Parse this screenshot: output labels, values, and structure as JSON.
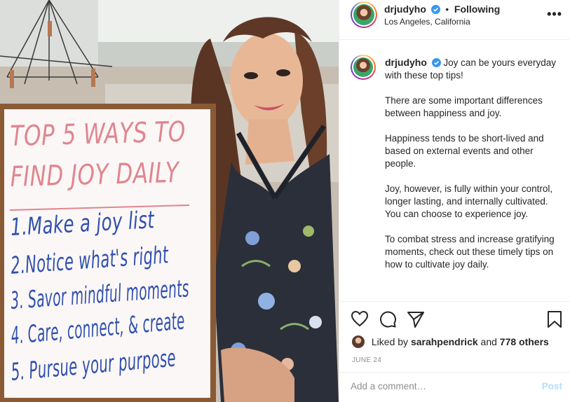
{
  "photo": {
    "board_title": [
      "TOP 5 WAYS TO",
      "FIND JOY DAILY"
    ],
    "board_items": [
      "1.Make a joy list",
      "2.Notice what's right",
      "3. Savor mindful moments",
      "4. Care, connect, & create",
      "5. Pursue your purpose"
    ]
  },
  "header": {
    "username": "drjudyho",
    "separator": "•",
    "follow_status": "Following",
    "location": "Los Angeles, California",
    "more": "•••"
  },
  "caption": {
    "username": "drjudyho",
    "paragraphs": [
      "Joy can be yours everyday with these top tips!",
      "There are some important differences between happiness and joy.",
      "Happiness tends to be short-lived and based on external events and other people.",
      "Joy, however, is fully within your control, longer lasting, and internally cultivated. You can choose to experience joy.",
      "To combat stress and increase gratifying moments, check out these timely tips on how to cultivate joy daily."
    ]
  },
  "likes": {
    "prefix": "Liked by",
    "user": "sarahpendrick",
    "middle": "and",
    "others": "778 others"
  },
  "date": "JUNE 24",
  "comment": {
    "placeholder": "Add a comment…",
    "post_label": "Post"
  },
  "icons": {
    "like": "heart-icon",
    "comment": "comment-icon",
    "share": "paper-plane-icon",
    "save": "bookmark-icon",
    "verified": "verified-badge-icon",
    "more": "more-options-icon"
  },
  "colors": {
    "verified": "#3897f0",
    "post_disabled": "#b2dffc",
    "muted": "#8e8e8e",
    "board_title": "#e0858f",
    "board_items": "#2f4fb0"
  }
}
